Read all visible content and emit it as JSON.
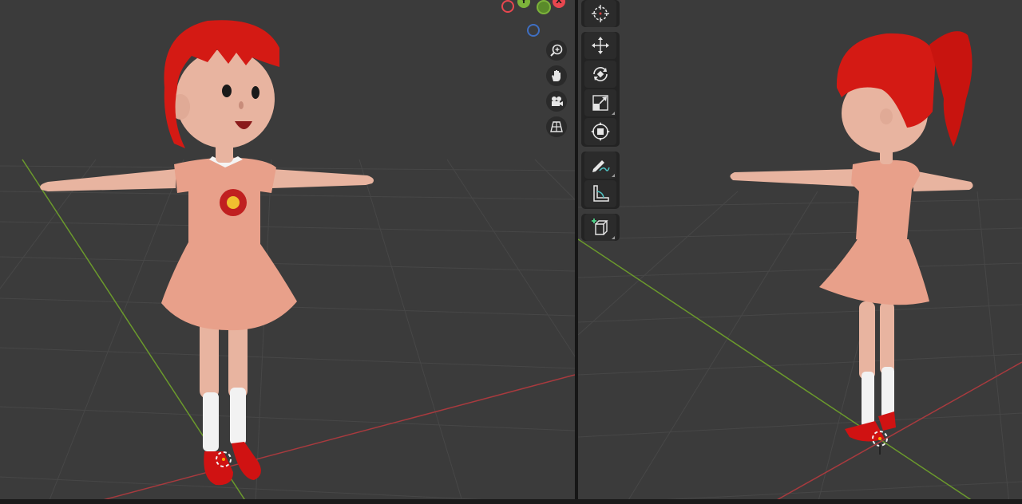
{
  "gizmo": {
    "x_label": "X",
    "y_label": "Y",
    "x_color": "#e8474f",
    "y_color": "#7cb33a",
    "z_color": "#3f6fc2"
  },
  "navigation": [
    {
      "name": "zoom-icon",
      "tooltip": ""
    },
    {
      "name": "pan-hand-icon",
      "tooltip": ""
    },
    {
      "name": "camera-view-icon",
      "tooltip": ""
    },
    {
      "name": "perspective-grid-icon",
      "tooltip": ""
    }
  ],
  "toolbar": [
    {
      "name": "cursor-tool-icon"
    },
    {
      "name": "move-tool-icon"
    },
    {
      "name": "rotate-tool-icon"
    },
    {
      "name": "scale-tool-icon"
    },
    {
      "name": "transform-tool-icon"
    },
    {
      "name": "annotate-tool-icon"
    },
    {
      "name": "measure-tool-icon"
    },
    {
      "name": "add-cube-tool-icon"
    }
  ],
  "colors": {
    "viewport_bg": "#3b3b3b",
    "grid_line": "#474747",
    "x_axis": "#a83a3e",
    "y_axis": "#6b9a2c",
    "hair": "#d41a14",
    "skin": "#e8b4a0",
    "dress": "#e8a08a",
    "sock": "#f2f2f2",
    "shoe": "#d01212"
  }
}
